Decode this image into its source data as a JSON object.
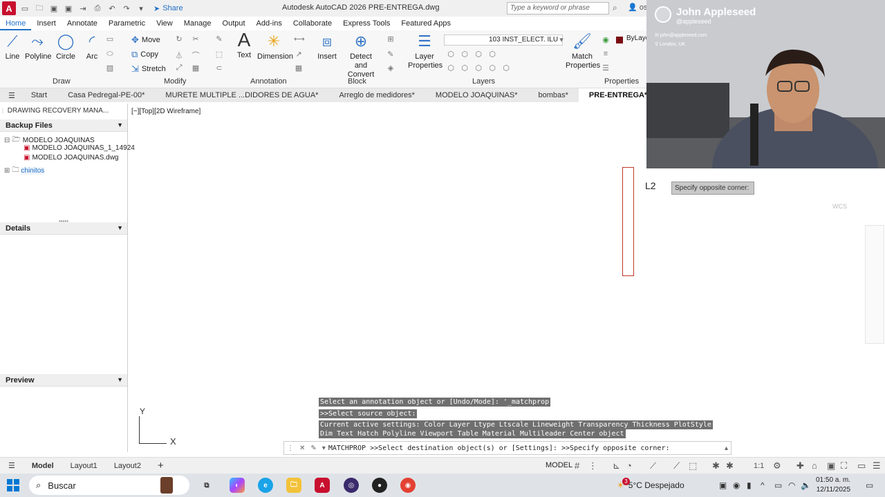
{
  "titlebar": {
    "app_logo": "A",
    "share_label": "Share",
    "title": "Autodesk AutoCAD 2026   PRE-ENTREGA.dwg",
    "search_placeholder": "Type a keyword or phrase",
    "user_short": "os"
  },
  "ribbon": {
    "tabs": [
      "Home",
      "Insert",
      "Annotate",
      "Parametric",
      "View",
      "Manage",
      "Output",
      "Add-ins",
      "Collaborate",
      "Express Tools",
      "Featured Apps"
    ],
    "draw": {
      "line": "Line",
      "polyline": "Polyline",
      "circle": "Circle",
      "arc": "Arc",
      "group": "Draw"
    },
    "modify": {
      "move": "Move",
      "copy": "Copy",
      "stretch": "Stretch",
      "group": "Modify"
    },
    "annotation": {
      "text": "Text",
      "dimension": "Dimension",
      "group": "Annotation"
    },
    "block": {
      "insert": "Insert",
      "detect": "Detect and",
      "convert": "Convert",
      "group": "Block"
    },
    "layers": {
      "layer_props_1": "Layer",
      "layer_props_2": "Properties",
      "current_layer": "103 INST_ELECT. ILU",
      "group": "Layers",
      "layer_color": "#7a0a12"
    },
    "properties": {
      "match_1": "Match",
      "match_2": "Properties",
      "bylayer": "ByLaye",
      "group": "Properties"
    }
  },
  "filetabs": {
    "menu_icon": "hamburger-icon",
    "tabs": [
      "Start",
      "Casa Pedregal-PE-00*",
      "MURETE MULTIPLE ...DIDORES DE AGUA*",
      "Arreglo de medidores*",
      "MODELO JOAQUINAS*",
      "bombas*",
      "PRE-ENTREGA*"
    ],
    "close": "✕",
    "add": "+"
  },
  "palette": {
    "title": "DRAWING RECOVERY MANA...",
    "backup_header": "Backup Files",
    "tree": [
      "MODELO JOAQUINAS",
      "MODELO JOAQUINAS_1_14924",
      "MODELO JOAQUINAS.dwg",
      "chinitos"
    ],
    "details_header": "Details",
    "preview_header": "Preview"
  },
  "viewport": {
    "label": "[−][Top][2D Wireframe]",
    "l2": "L2",
    "tooltip": "Specify opposite corner:",
    "wcs": "WCS",
    "ucs_x": "X",
    "ucs_y": "Y"
  },
  "command": {
    "history": [
      "Select an annotation object or [Undo/Mode]: '_matchprop",
      ">>Select source object:",
      "Current active settings:  Color Layer Ltype Ltscale Lineweight Transparency Thickness PlotStyle",
      "Dim Text Hatch Polyline Viewport Table Material Multileader Center object"
    ],
    "current": "MATCHPROP >>Select destination object(s) or [Settings]: >>Specify opposite corner:"
  },
  "statusbar": {
    "layouts": [
      "Model",
      "Layout1",
      "Layout2"
    ],
    "add": "+",
    "model": "MODEL",
    "scale": "1:1"
  },
  "taskbar": {
    "search": "Buscar",
    "weather": "5°C  Despejado",
    "time": "01:50 a. m.",
    "date": "12/11/2025",
    "badge": "3"
  },
  "webcam": {
    "name": "John Appleseed",
    "handle": "@appleseed",
    "email": "john@appleseed.com",
    "location": "London, UK"
  },
  "colors": {
    "accent": "#1f6fc5",
    "autocad_red": "#c8102e",
    "object_red": "#c0392b"
  }
}
